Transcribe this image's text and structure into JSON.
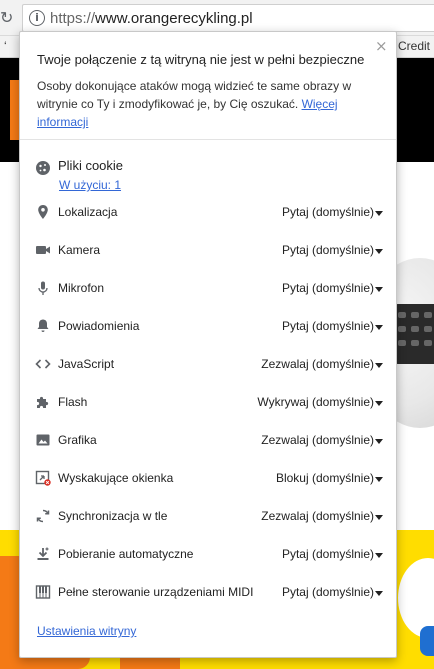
{
  "browser": {
    "url_scheme": "https://",
    "url_host": "www.orangerecykling.pl",
    "bookmark_fragment": "‘",
    "bookmark_credit": "Credit"
  },
  "popup": {
    "title": "Twoje połączenie z tą witryną nie jest w pełni bezpieczne",
    "description": "Osoby dokonujące ataków mogą widzieć te same obrazy w witrynie co Ty i zmodyfikować je, by Cię oszukać.",
    "more_link": "Więcej informacji",
    "close_symbol": "×",
    "cookies": {
      "label": "Pliki cookie",
      "in_use_link": "W użyciu: 1"
    },
    "permissions": [
      {
        "label": "Lokalizacja",
        "value": "Pytaj (domyślnie)",
        "icon": "location-pin-icon"
      },
      {
        "label": "Kamera",
        "value": "Pytaj (domyślnie)",
        "icon": "camera-icon"
      },
      {
        "label": "Mikrofon",
        "value": "Pytaj (domyślnie)",
        "icon": "microphone-icon"
      },
      {
        "label": "Powiadomienia",
        "value": "Pytaj (domyślnie)",
        "icon": "bell-icon"
      },
      {
        "label": "JavaScript",
        "value": "Zezwalaj (domyślnie)",
        "icon": "code-icon"
      },
      {
        "label": "Flash",
        "value": "Wykrywaj (domyślnie)",
        "icon": "puzzle-icon"
      },
      {
        "label": "Grafika",
        "value": "Zezwalaj (domyślnie)",
        "icon": "image-icon"
      },
      {
        "label": "Wyskakujące okienka",
        "value": "Blokuj (domyślnie)",
        "icon": "popup-blocked-icon"
      },
      {
        "label": "Synchronizacja w tle",
        "value": "Zezwalaj (domyślnie)",
        "icon": "sync-icon"
      },
      {
        "label": "Pobieranie automatyczne",
        "value": "Pytaj (domyślnie)",
        "icon": "download-icon"
      },
      {
        "label": "Pełne sterowanie urządzeniami MIDI",
        "value": "Pytaj (domyślnie)",
        "icon": "piano-keys-icon"
      }
    ],
    "site_settings_link": "Ustawienia witryny"
  },
  "colors": {
    "link": "#3367d6",
    "accent_orange": "#f47a16",
    "accent_yellow": "#ffdd00"
  }
}
